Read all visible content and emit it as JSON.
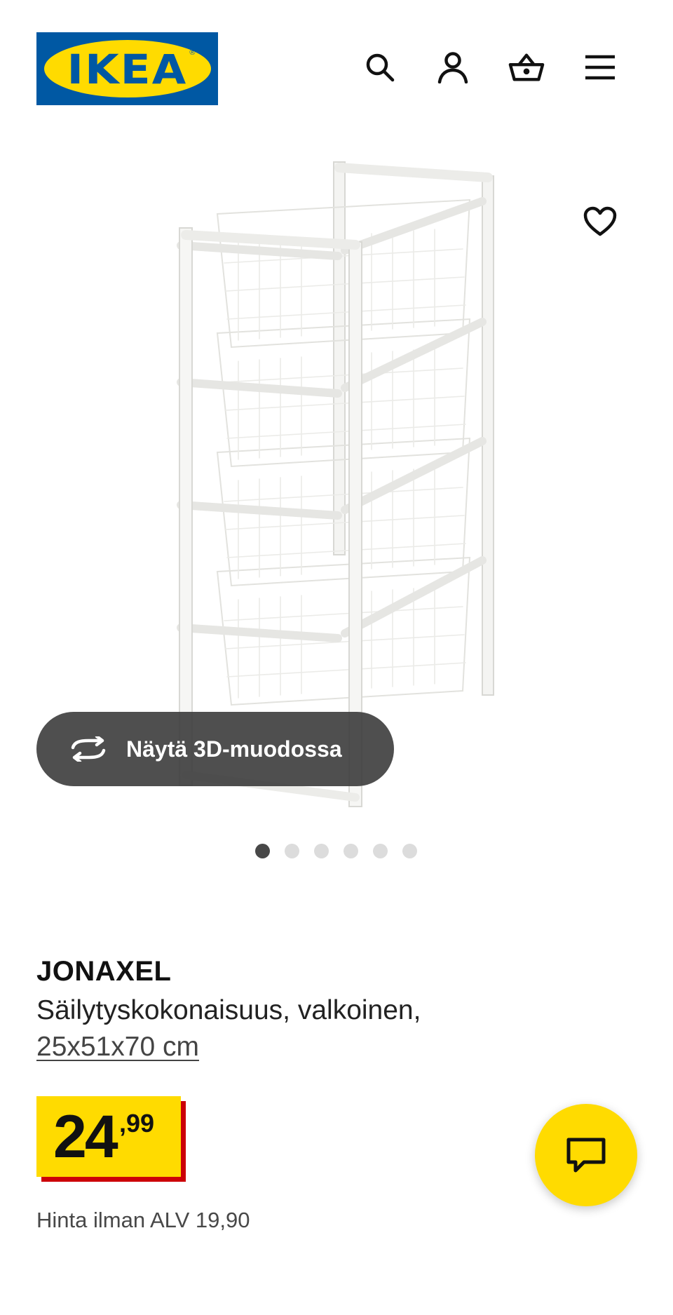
{
  "header": {
    "logo_text": "IKEA",
    "logo_reg": "®",
    "icons": [
      "search-icon",
      "account-icon",
      "basket-icon",
      "menu-icon"
    ]
  },
  "gallery": {
    "view_3d_label": "Näytä 3D-muodossa",
    "image_count": 6,
    "active_index": 0
  },
  "product": {
    "name": "JONAXEL",
    "description": "Säilytyskokonaisuus, valkoinen,",
    "dimensions": "25x51x70 cm",
    "price_integer": "24",
    "price_decimal": ",99",
    "price_ex_vat": "Hinta ilman ALV 19,90"
  },
  "colors": {
    "brand_blue": "#0058a3",
    "brand_yellow": "#ffdb00",
    "price_shadow_red": "#cc0008",
    "button_dark": "#3c3c3c"
  }
}
